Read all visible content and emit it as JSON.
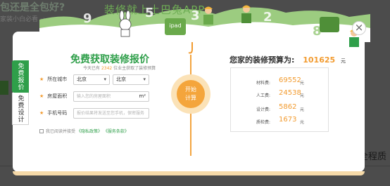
{
  "background": {
    "top_headline": "包还是全包好?",
    "top_sub": "家装小白必看 →",
    "bottom_left": "",
    "bottom_right": "全程质"
  },
  "banner": {
    "slogan": "装修就上土巴兔APP",
    "numbers": [
      "9",
      "5",
      "3",
      "2",
      "8"
    ],
    "bag_label": "ipad"
  },
  "side_tabs": [
    {
      "label": "免费报价",
      "active": true
    },
    {
      "label": "免费设计",
      "active": false
    }
  ],
  "form": {
    "title": "免费获取装修报价",
    "sub_prefix": "今天已有",
    "sub_count": "2342",
    "sub_suffix": "位业主获取了装修预算",
    "city_label": "所在城市",
    "province_value": "北京",
    "city_value": "北京",
    "area_label": "房屋面积",
    "area_placeholder": "输入您的房屋面积",
    "area_unit": "m²",
    "phone_label": "手机号码",
    "phone_placeholder": "报价结果将发送至您手机，保密服务",
    "agree_text": "我已阅读并接受",
    "privacy_link": "《隐私政策》",
    "service_link": "《服务条款》"
  },
  "calc_button": {
    "line1": "开始",
    "line2": "计算"
  },
  "result": {
    "title": "您家的装修预算为:",
    "total": "101625",
    "total_unit": "元",
    "items": [
      {
        "label": "材料费:",
        "value": "69552",
        "unit": "元"
      },
      {
        "label": "人工费:",
        "value": "24538",
        "unit": "元"
      },
      {
        "label": "设计费:",
        "value": "5862",
        "unit": "元"
      },
      {
        "label": "质检费:",
        "value": "1673",
        "unit": "元"
      }
    ]
  },
  "close_label": "×",
  "icons": [
    "close-icon",
    "rabbit-mascot",
    "worker-figure",
    "chevron-down-icon"
  ],
  "colors": {
    "accent_green": "#2f9f4a",
    "accent_orange": "#f29b2f"
  }
}
